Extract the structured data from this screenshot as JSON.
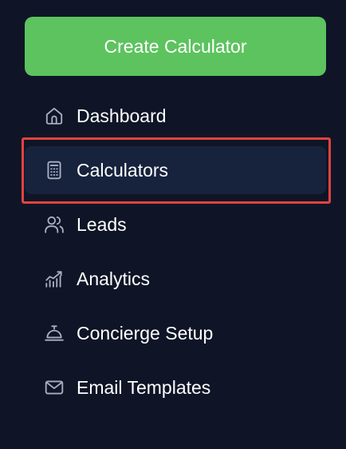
{
  "create_button": {
    "label": "Create Calculator"
  },
  "nav": {
    "items": [
      {
        "label": "Dashboard",
        "icon": "home-icon",
        "active": false
      },
      {
        "label": "Calculators",
        "icon": "calculator-icon",
        "active": true
      },
      {
        "label": "Leads",
        "icon": "users-icon",
        "active": false
      },
      {
        "label": "Analytics",
        "icon": "analytics-icon",
        "active": false
      },
      {
        "label": "Concierge Setup",
        "icon": "bell-service-icon",
        "active": false
      },
      {
        "label": "Email Templates",
        "icon": "mail-icon",
        "active": false
      }
    ]
  },
  "colors": {
    "background": "#0f1527",
    "primary_button": "#5cc35f",
    "active_item": "#17233d",
    "icon": "#a7b0c0",
    "highlight": "#e0443f"
  }
}
